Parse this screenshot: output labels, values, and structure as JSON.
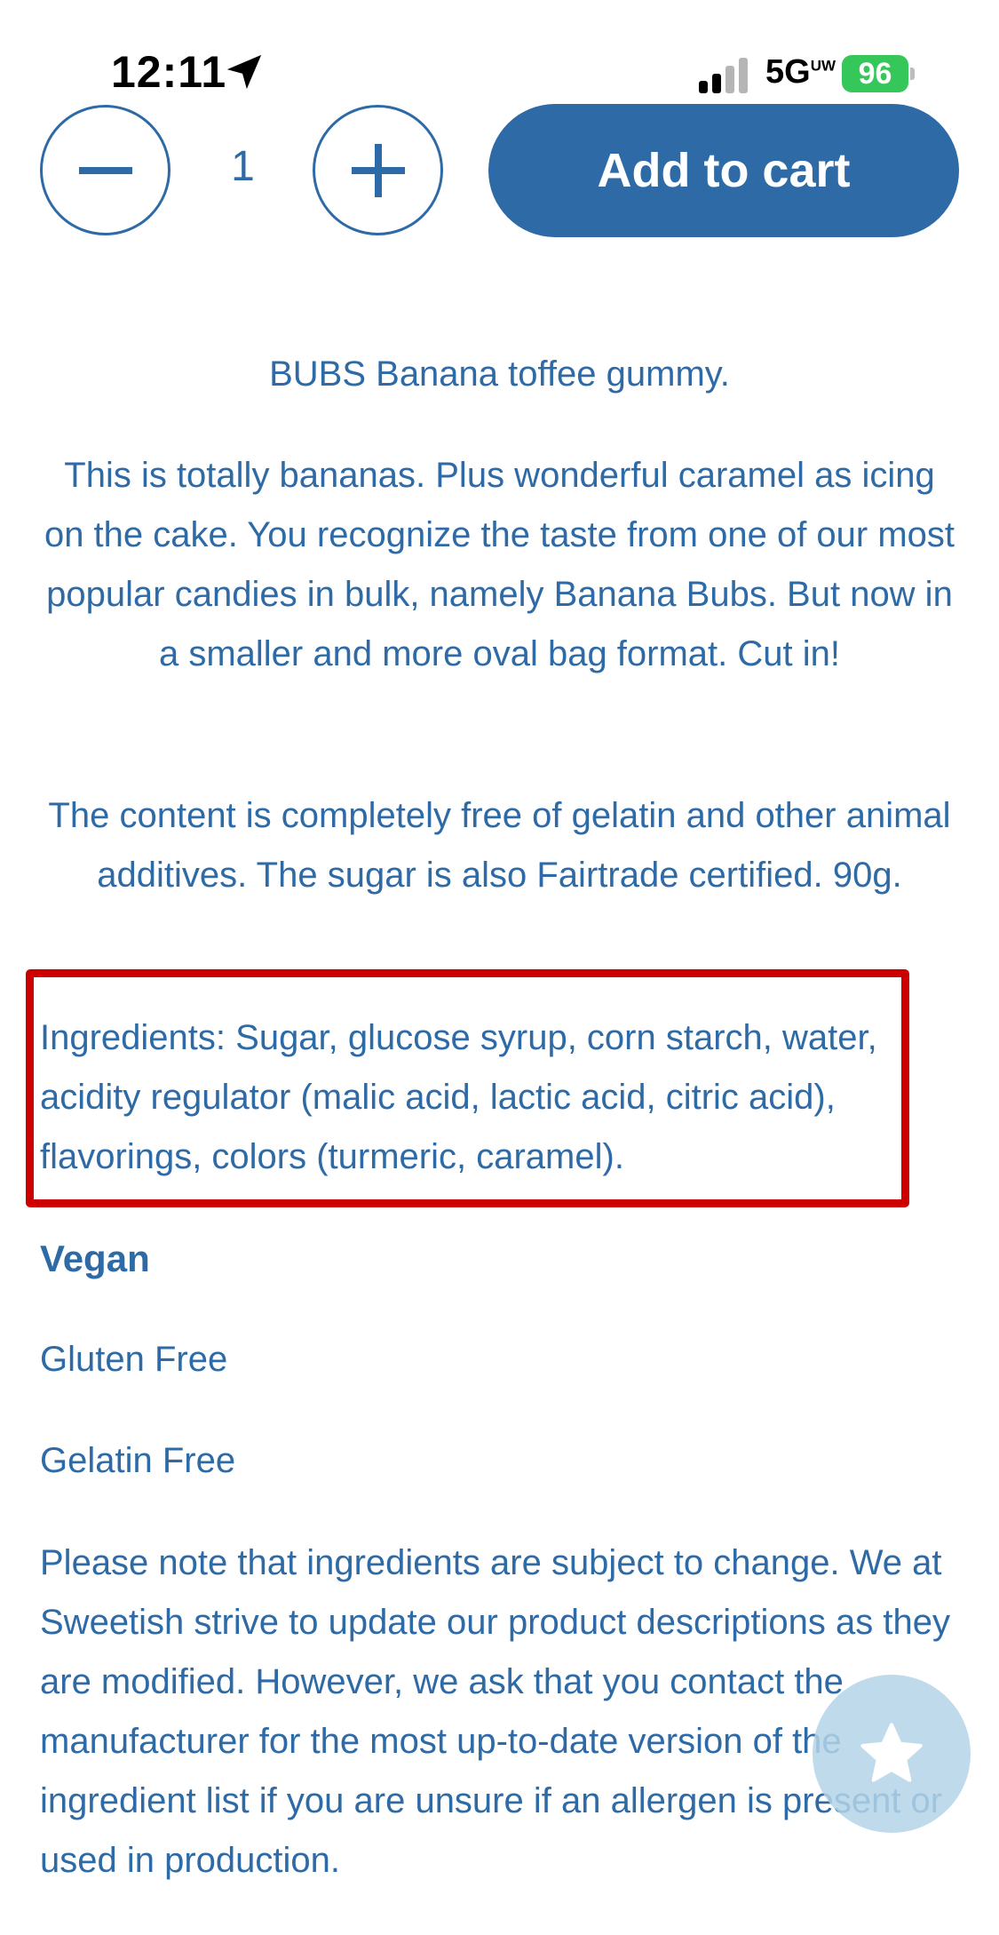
{
  "status_bar": {
    "time": "12:11",
    "network": "5G",
    "network_suffix": "UW",
    "battery": "96"
  },
  "purchase": {
    "quantity": "1",
    "add_to_cart_label": "Add to cart"
  },
  "description": {
    "title_line": "BUBS Banana toffee gummy.",
    "intro": "This is totally bananas. Plus wonderful caramel as icing on the cake. You recognize the taste from one of our most popular candies in bulk, namely Banana Bubs. But now in a smaller and more oval bag format. Cut in!",
    "content_note": "The content is completely free of gelatin and other animal additives. The sugar is also Fairtrade certified. 90g.",
    "ingredients": "Ingredients: Sugar, glucose syrup, corn starch, water, acidity regulator (malic acid, lactic acid, citric acid), flavorings, colors (turmeric, caramel).",
    "badges": [
      "Vegan",
      "Gluten Free",
      "Gelatin Free"
    ],
    "disclaimer": "Please note that ingredients are subject to change. We at Sweetish strive to update our product descriptions as they are modified. However, we ask that you contact the manufacturer for the most up-to-date version of the ingredient list if you are unsure if an allergen is present or used in production."
  },
  "colors": {
    "brand_blue": "#2d6aa6",
    "highlight_red": "#cc0000",
    "battery_green": "#35c759"
  },
  "icons": {
    "location": "location-arrow-icon",
    "signal": "signal-bars-icon",
    "minus": "minus-icon",
    "plus": "plus-icon",
    "favorite": "star-icon"
  }
}
